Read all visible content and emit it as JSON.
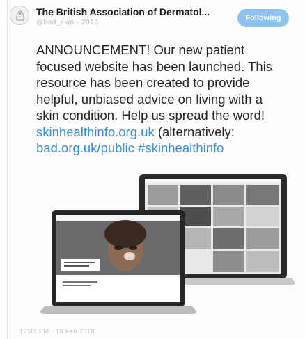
{
  "tweet": {
    "account_name": "The British Association of Dermatol...",
    "handle": "@bad_skin · 2018",
    "follow_label": "Following",
    "text": {
      "line1": "ANNOUNCEMENT! Our new patient",
      "line2": "focused website has been launched. This",
      "line3": "resource has been created to provide",
      "line4": "helpful, unbiased advice on living with a",
      "line5": "skin condition. Help us spread the word!",
      "link1": "skinhealthinfo.org.uk",
      "line6_suffix": " (alternatively:",
      "link2": "bad.org.uk/public",
      "hashtag": "#skinhealthinfo"
    },
    "media": {
      "laptop_front_caption1": "Your skin is the mirror of everything we do",
      "laptop_front_caption2": "Helpful advice on living with a skin condition"
    },
    "meta_text": "12:41 PM · 19 Feb 2018"
  },
  "colors": {
    "link": "#3a8fd6",
    "follow_button": "#8dc3ee"
  }
}
